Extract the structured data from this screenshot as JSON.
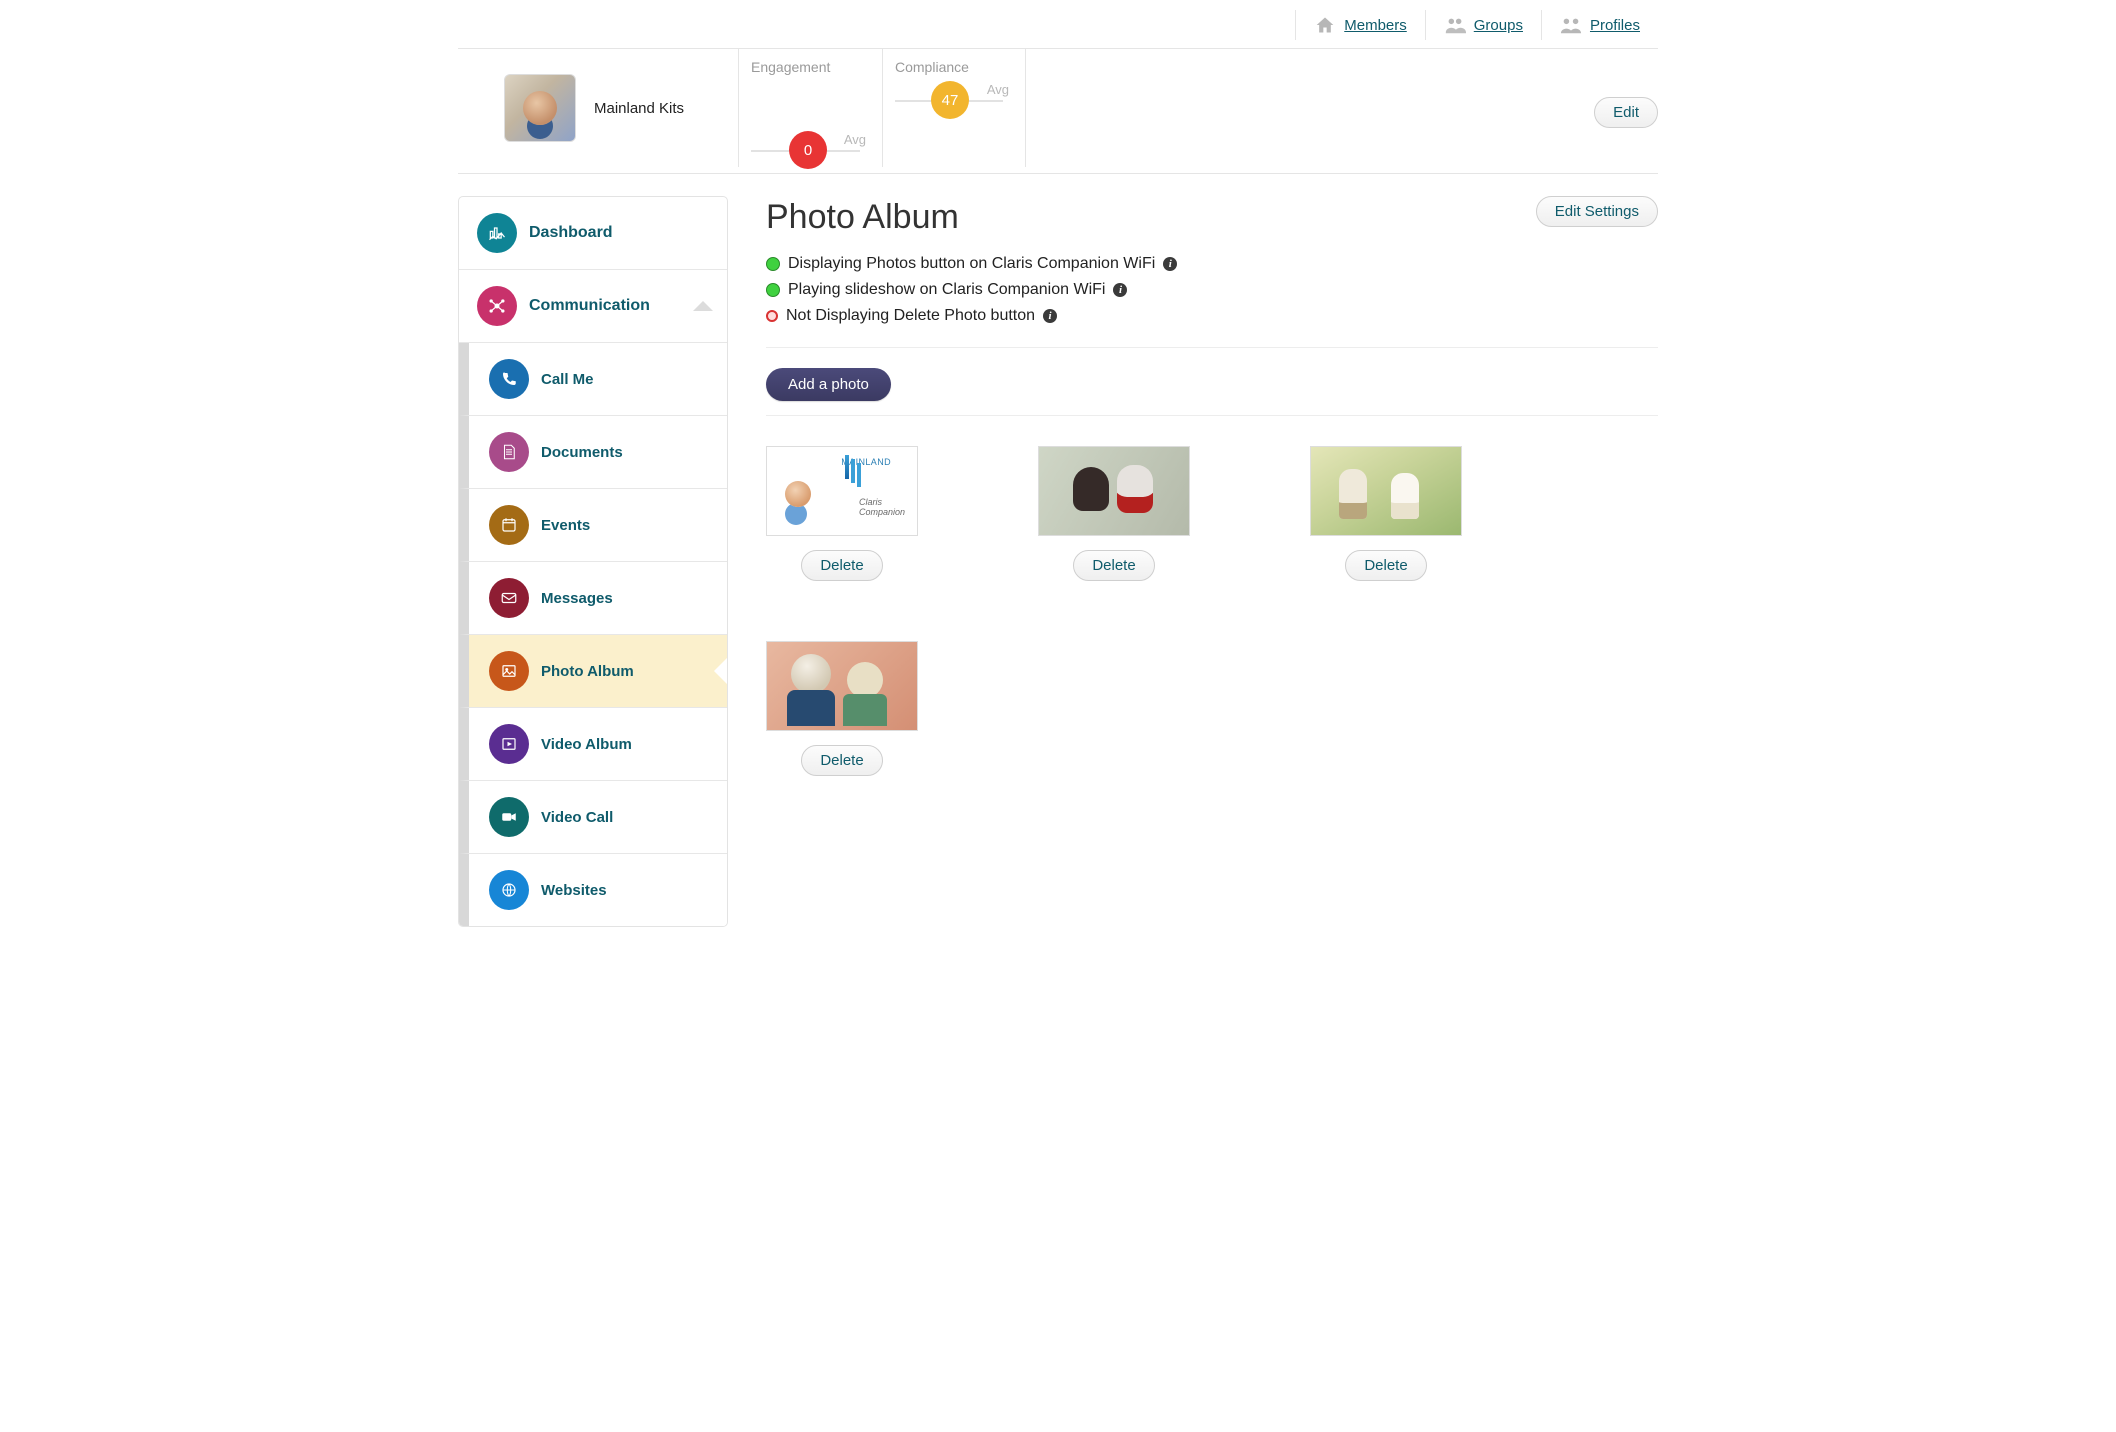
{
  "topnav": {
    "members": "Members",
    "groups": "Groups",
    "profiles": "Profiles"
  },
  "header": {
    "member_name": "Mainland Kits",
    "engagement_label": "Engagement",
    "engagement_value": "0",
    "engagement_avg": "Avg",
    "compliance_label": "Compliance",
    "compliance_value": "47",
    "compliance_avg": "Avg",
    "edit_btn": "Edit"
  },
  "sidebar": {
    "dashboard": "Dashboard",
    "communication": "Communication",
    "items": {
      "call_me": "Call Me",
      "documents": "Documents",
      "events": "Events",
      "messages": "Messages",
      "photo_album": "Photo Album",
      "video_album": "Video Album",
      "video_call": "Video Call",
      "websites": "Websites"
    }
  },
  "content": {
    "title": "Photo Album",
    "edit_settings": "Edit Settings",
    "status": {
      "s1": "Displaying Photos button on Claris Companion WiFi",
      "s2": "Playing slideshow on Claris Companion WiFi",
      "s3": "Not Displaying Delete Photo button"
    },
    "add_photo": "Add a photo",
    "delete": "Delete"
  }
}
